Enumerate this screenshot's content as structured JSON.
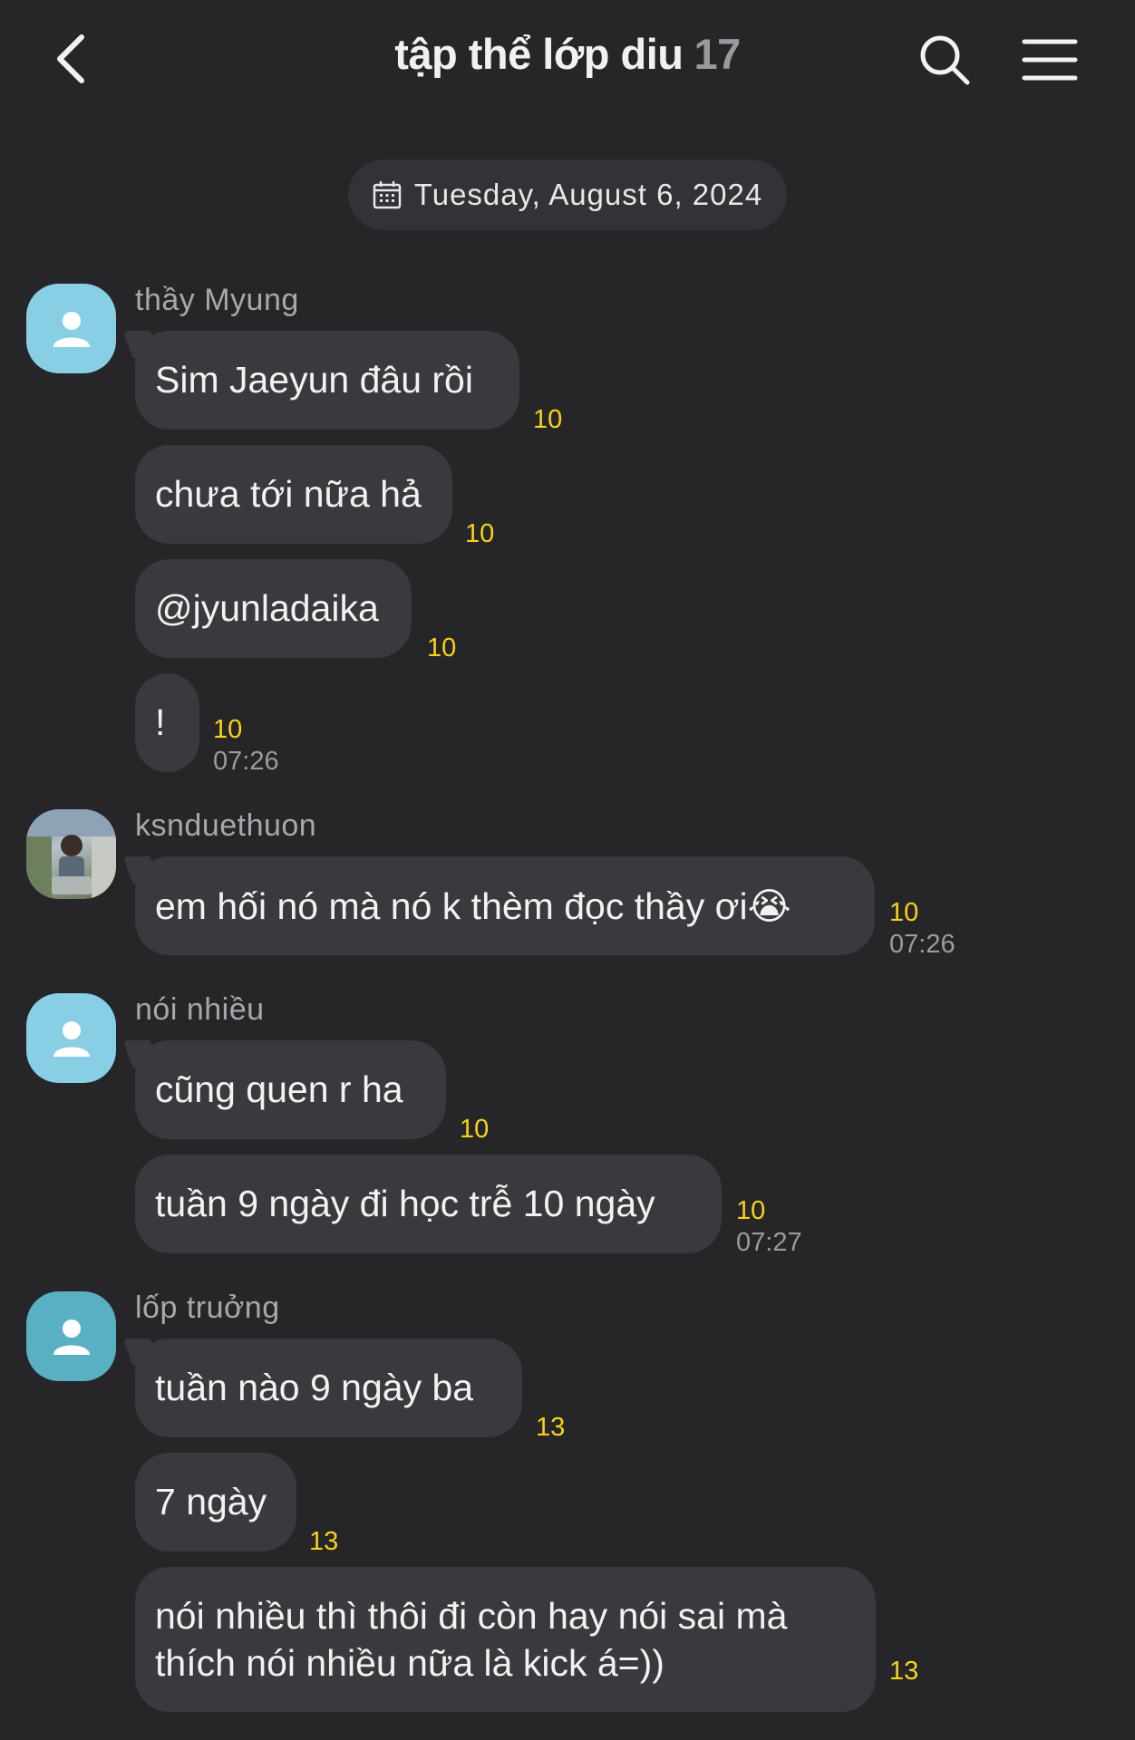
{
  "header": {
    "title": "tập thể lớp diu",
    "member_count": "17",
    "back_icon": "chevron-left-icon",
    "search_icon": "search-icon",
    "menu_icon": "hamburger-menu-icon"
  },
  "date_divider": {
    "icon": "calendar-icon",
    "label": "Tuesday, August 6, 2024"
  },
  "colors": {
    "background": "#262629",
    "bubble": "#3a3a3e",
    "unread": "#f7d21a"
  },
  "groups": [
    {
      "sender": "thầy Myung",
      "messages": [
        {
          "text": "Sim Jaeyun đâu rồi",
          "unread": "10",
          "time": ""
        },
        {
          "text": "chưa tới nữa hả",
          "unread": "10",
          "time": ""
        },
        {
          "text": "@jyunladaika",
          "unread": "10",
          "time": ""
        },
        {
          "text": "!",
          "unread": "10",
          "time": "07:26"
        }
      ]
    },
    {
      "sender": "ksnduethuon",
      "messages": [
        {
          "text": "em hối nó mà nó k thèm đọc thầy ơi😭",
          "unread": "10",
          "time": "07:26"
        }
      ]
    },
    {
      "sender": "nói nhiều",
      "messages": [
        {
          "text": "cũng quen r ha",
          "unread": "10",
          "time": ""
        },
        {
          "text": "tuần 9 ngày đi học trễ 10 ngày",
          "unread": "10",
          "time": "07:27"
        }
      ]
    },
    {
      "sender": "lốp truởng",
      "messages": [
        {
          "text": "tuần nào 9 ngày ba",
          "unread": "13",
          "time": ""
        },
        {
          "text": "7 ngày",
          "unread": "13",
          "time": ""
        },
        {
          "text": "nói nhiều thì thôi đi còn hay nói sai mà thích nói nhiều nữa là kick á=))",
          "unread": "13",
          "time": ""
        }
      ]
    }
  ]
}
